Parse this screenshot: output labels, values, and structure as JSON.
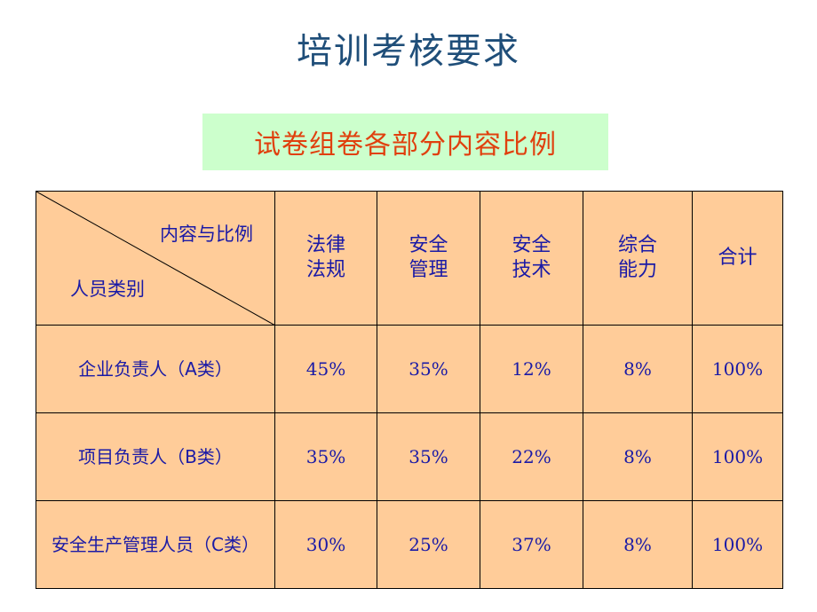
{
  "title": "培训考核要求",
  "subtitle": "试卷组卷各部分内容比例",
  "colors": {
    "title": "#1f4e79",
    "subtitle": "#e0400e",
    "subtitle_bg": "#ccffcc",
    "table_bg": "#ffcc99",
    "table_text": "#1a1aa6"
  },
  "table": {
    "corner": {
      "top_label": "内容与比例",
      "bottom_label": "人员类别"
    },
    "columns": [
      {
        "line1": "法律",
        "line2": "法规"
      },
      {
        "line1": "安全",
        "line2": "管理"
      },
      {
        "line1": "安全",
        "line2": "技术"
      },
      {
        "line1": "综合",
        "line2": "能力"
      },
      {
        "line1": "合计",
        "line2": ""
      }
    ],
    "rows": [
      {
        "label": "企业负责人（A类）",
        "values": [
          "45%",
          "35%",
          "12%",
          "8%",
          "100%"
        ]
      },
      {
        "label": "项目负责人（B类）",
        "values": [
          "35%",
          "35%",
          "22%",
          "8%",
          "100%"
        ]
      },
      {
        "label": "安全生产管理人员（C类）",
        "values": [
          "30%",
          "25%",
          "37%",
          "8%",
          "100%"
        ]
      }
    ]
  }
}
